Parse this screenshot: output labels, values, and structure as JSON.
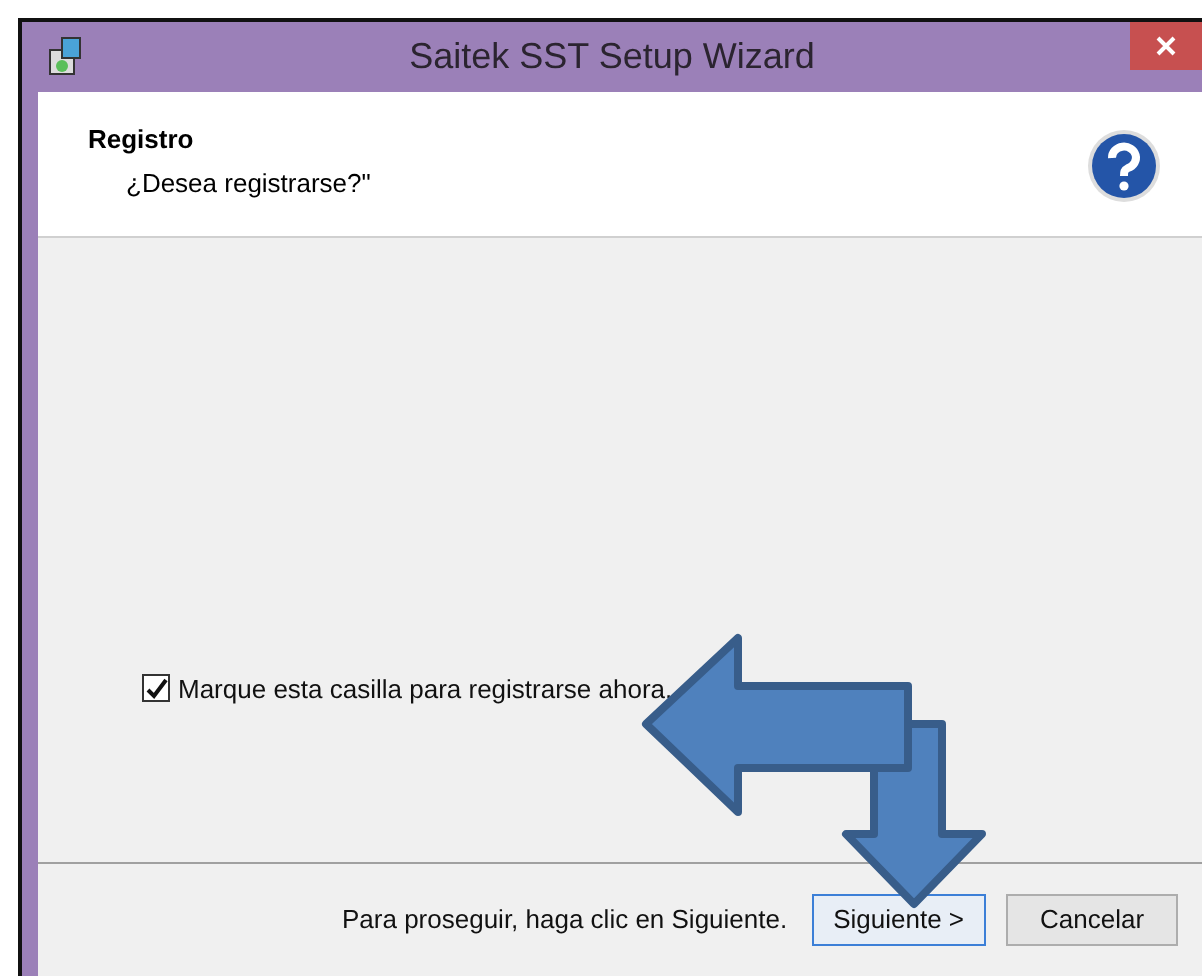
{
  "window": {
    "title": "Saitek SST Setup Wizard"
  },
  "header": {
    "title": "Registro",
    "subtitle": "¿Desea registrarse?\""
  },
  "checkbox": {
    "label": "Marque esta casilla para registrarse ahora.",
    "checked": true
  },
  "footer": {
    "hint": "Para proseguir, haga clic en Siguiente."
  },
  "buttons": [
    {
      "label": "Siguiente >",
      "focused": true
    },
    {
      "label": "Cancelar",
      "focused": false
    }
  ]
}
